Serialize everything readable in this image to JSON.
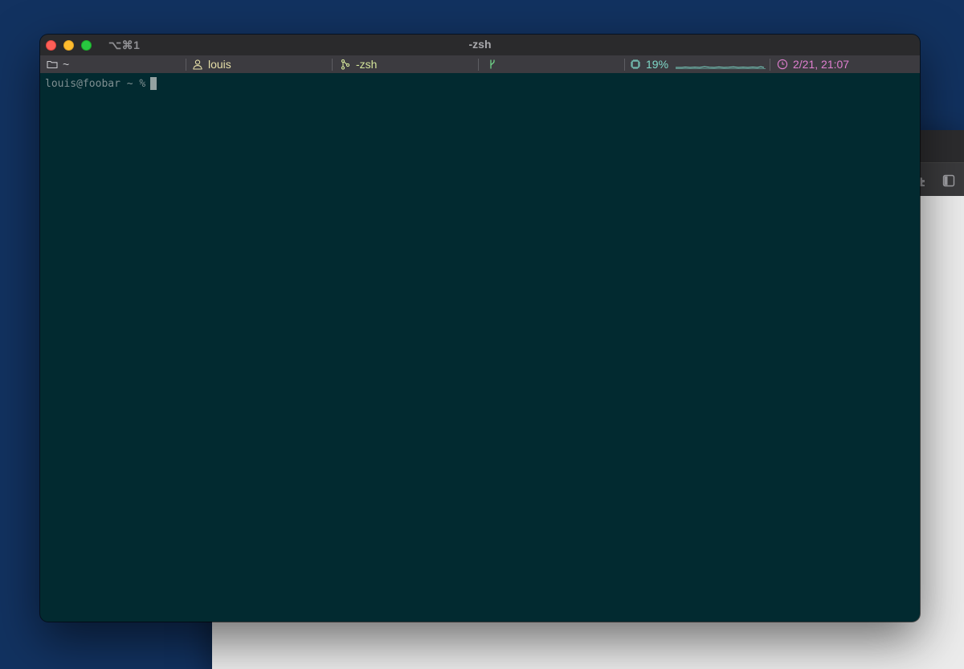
{
  "terminal": {
    "shortcut": "⌥⌘1",
    "title": "-zsh",
    "status_bar": {
      "directory": {
        "icon": "folder-icon",
        "value": "~",
        "color": "#c8c8cc"
      },
      "user": {
        "icon": "user-icon",
        "value": "louis",
        "color": "#e6dfa8"
      },
      "job": {
        "icon": "process-icon",
        "value": "-zsh",
        "color": "#d4e59a"
      },
      "git": {
        "icon": "git-branch-icon",
        "value": "",
        "color": "#6fd388"
      },
      "cpu": {
        "icon": "cpu-icon",
        "value": "19%",
        "color": "#7fd9c9"
      },
      "clock": {
        "icon": "clock-icon",
        "value": "2/21, 21:07",
        "color": "#e07fd0"
      }
    },
    "prompt": {
      "text": "louis@foobar ~ %"
    }
  },
  "background_window": {
    "icons": [
      "puzzle-icon",
      "sidebar-icon"
    ]
  }
}
